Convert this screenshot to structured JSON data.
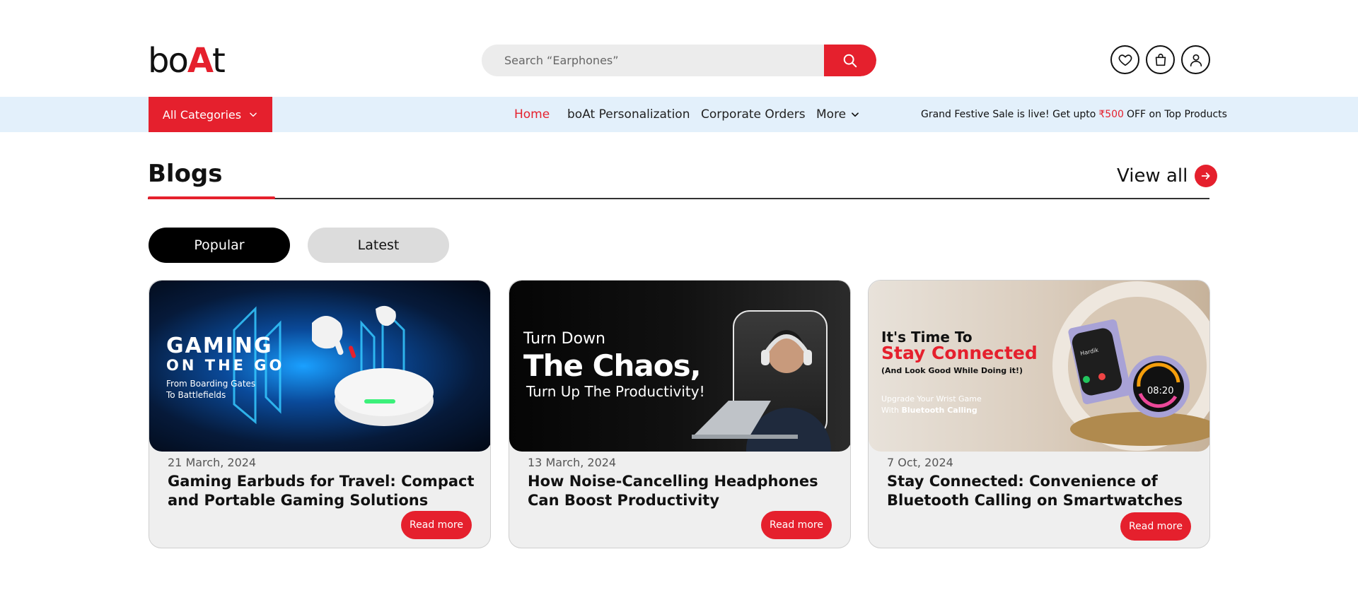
{
  "header": {
    "logo_prefix": "bo",
    "logo_a": "A",
    "logo_suffix": "t",
    "search_placeholder": "Search “Earphones”",
    "search_icon": "search-icon",
    "wishlist_icon": "heart-icon",
    "cart_icon": "shopping-bag-icon",
    "account_icon": "user-icon"
  },
  "nav": {
    "categories_label": "All Categories",
    "links": [
      "Home",
      "boAt Personalization",
      "Corporate Orders",
      "More"
    ],
    "promo_prefix": "Grand Festive Sale is live! Get upto",
    "promo_amount": "₹500",
    "promo_suffix": "OFF on Top Products"
  },
  "blogs": {
    "title": "Blogs",
    "view_all": "View all",
    "tabs": [
      "Popular",
      "Latest"
    ],
    "active_tab": "Popular",
    "cards": [
      {
        "date": "21 March, 2024",
        "title": "Gaming Earbuds for Travel: Compact and Portable Gaming Solutions",
        "cta": "Read more",
        "banner": {
          "line1": "GAMING",
          "line2": "ON THE GO",
          "line3": "From Boarding Gates",
          "line4": "To Battlefields"
        }
      },
      {
        "date": "13 March, 2024",
        "title": "How Noise-Cancelling Headphones Can Boost Productivity",
        "cta": "Read more",
        "banner": {
          "line1": "Turn Down",
          "line2": "The Chaos,",
          "line3": "Turn Up The Productivity!"
        }
      },
      {
        "date": "7 Oct, 2024",
        "title": "Stay Connected: Convenience of Bluetooth Calling on Smartwatches",
        "cta": "Read more",
        "banner": {
          "line1": "It's Time To",
          "line2": "Stay Connected",
          "line3": "(And Look Good While Doing it!)",
          "line4": "Upgrade Your Wrist Game",
          "line5_prefix": "With",
          "line5_bold": "Bluetooth Calling",
          "watch_time": "08:20",
          "watch_caller": "Hardik"
        }
      }
    ]
  },
  "colors": {
    "accent": "#e5202d",
    "nav_bg": "#e3f0fb",
    "card_bg": "#efefef"
  }
}
